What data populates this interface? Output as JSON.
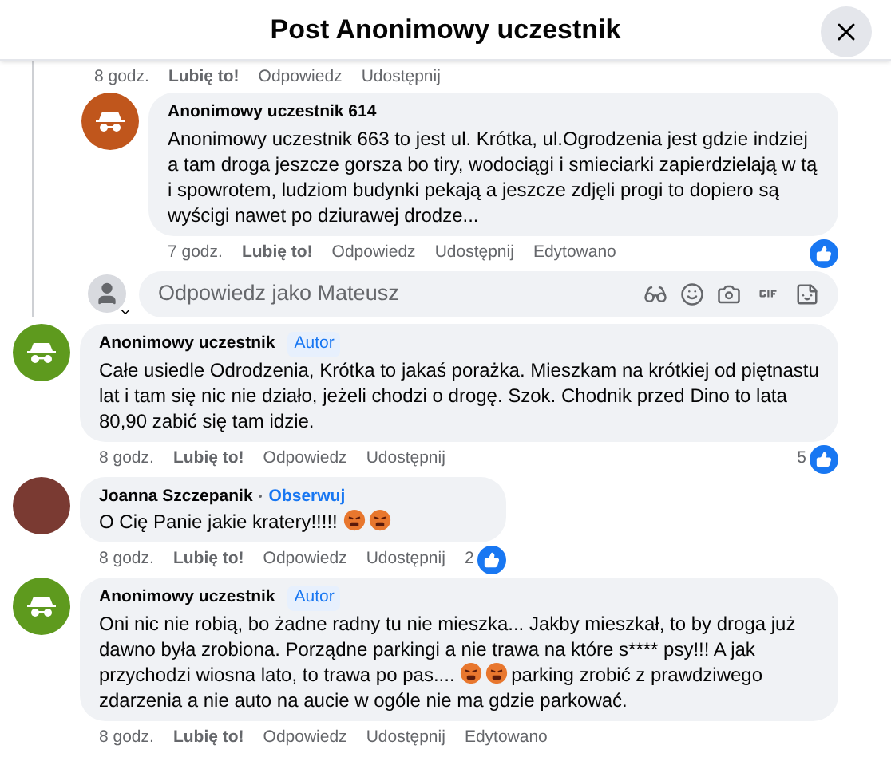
{
  "header": {
    "title": "Post Anonimowy uczestnik"
  },
  "thread": {
    "time": "8 godz.",
    "actions": [
      "Lubię to!",
      "Odpowiedz",
      "Udostępnij"
    ],
    "children": [
      {
        "kind": "comment",
        "author": "Anonimowy uczestnik 614",
        "avatar": {
          "kind": "anonymous",
          "color": "#c0561c"
        },
        "body": [
          {
            "kind": "text",
            "text": "Anonimowy uczestnik 663 to jest ul. Krótka, ul.Ogrodzenia jest gdzie indziej a tam droga jeszcze gorsza bo tiry, wodociągi i smieciarki zapierdzielają w tą i spowrotem, ludziom budynki pekają a jeszcze zdjęli progi to dopiero są wyścigi nawet po dziurawej drodze..."
          }
        ],
        "time": "7 godz.",
        "actions": [
          "Lubię to!",
          "Odpowiedz",
          "Udostępnij"
        ],
        "edited": "Edytowano",
        "reaction": true
      },
      {
        "kind": "reply_box",
        "placeholder": "Odpowiedz jako Mateusz"
      }
    ]
  },
  "comments": [
    {
      "author": "Anonimowy uczestnik",
      "badge": {
        "kind": "author",
        "label": "Autor"
      },
      "avatar": {
        "kind": "anonymous",
        "color": "#5e9a1e"
      },
      "body": [
        {
          "kind": "text",
          "text": "Całe usiedle Odrodzenia, Krótka to jakaś porażka. Mieszkam na krótkiej od piętnastu lat i tam się nic nie działo, jeżeli chodzi o drogę. Szok. Chodnik przed Dino to lata 80,90 zabić się tam idzie."
        }
      ],
      "time": "8 godz.",
      "actions": [
        "Lubię to!",
        "Odpowiedz",
        "Udostępnij"
      ],
      "likes": "5",
      "reaction": true
    },
    {
      "author": "Joanna Szczepanik",
      "badge": {
        "kind": "follow",
        "label": "Obserwuj"
      },
      "avatar": {
        "kind": "photo"
      },
      "body": [
        {
          "kind": "text",
          "text": "O Cię Panie jakie kratery!!!!!"
        },
        {
          "kind": "emoji"
        },
        {
          "kind": "emoji"
        }
      ],
      "time": "8 godz.",
      "actions": [
        "Lubię to!",
        "Odpowiedz",
        "Udostępnij"
      ],
      "likes": "2",
      "reaction": true
    },
    {
      "author": "Anonimowy uczestnik",
      "badge": {
        "kind": "author",
        "label": "Autor"
      },
      "avatar": {
        "kind": "anonymous",
        "color": "#5e9a1e"
      },
      "body": [
        {
          "kind": "text",
          "text": "Oni nic nie robią, bo żadne radny tu nie mieszka... Jakby mieszkał, to by droga już dawno była zrobiona. Porządne parkingi a nie trawa na które s**** psy!!! A jak przychodzi wiosna lato, to trawa po pas...."
        },
        {
          "kind": "emoji"
        },
        {
          "kind": "emoji"
        },
        {
          "kind": "text",
          "text": "parking zrobić z prawdziwego zdarzenia a nie auto na aucie w ogóle nie ma gdzie parkować."
        }
      ],
      "time": "8 godz.",
      "actions": [
        "Lubię to!",
        "Odpowiedz",
        "Udostępnij"
      ],
      "edited": "Edytowano"
    }
  ]
}
